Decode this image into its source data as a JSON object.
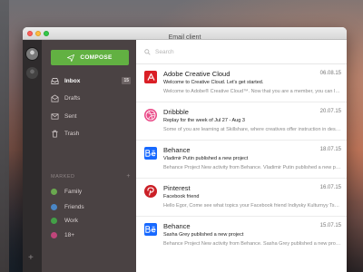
{
  "window": {
    "title": "Email client"
  },
  "sidebar": {
    "compose_label": "COMPOSE",
    "nav": [
      {
        "label": "Inbox",
        "badge": "15",
        "icon": "inbox-icon",
        "active": true
      },
      {
        "label": "Drafts",
        "icon": "drafts-icon"
      },
      {
        "label": "Sent",
        "icon": "sent-icon"
      },
      {
        "label": "Trash",
        "icon": "trash-icon"
      }
    ],
    "marked_heading": "MARKED",
    "marked_add": "+",
    "tags": [
      {
        "label": "Family",
        "color": "#6aa84f"
      },
      {
        "label": "Friends",
        "color": "#4a86c5"
      },
      {
        "label": "Work",
        "color": "#43a047"
      },
      {
        "label": "18+",
        "color": "#c0457a"
      }
    ]
  },
  "search": {
    "placeholder": "Search"
  },
  "emails": [
    {
      "sender": "Adobe Creative Cloud",
      "date": "06.08.15",
      "subject": "Welcome to Creative Cloud. Let's get started.",
      "preview": "Welcome to Adobe® Creative Cloud™. Now that you are a member, you can log in to your",
      "icon": "adobe-icon"
    },
    {
      "sender": "Dribbble",
      "date": "20.07.15",
      "subject": "Replay for the week of Jul 27 - Aug 3",
      "preview": "Some of you are learning at Skillshare, where creatives offer instruction in design and more",
      "icon": "dribbble-icon"
    },
    {
      "sender": "Behance",
      "date": "18.07.15",
      "subject": "Vladimir Putin published a new project",
      "preview": "Behance Project New activity from Behance. Vladimir Putin published a new project.",
      "icon": "behance-icon"
    },
    {
      "sender": "Pinterest",
      "date": "16.07.15",
      "subject": "Facebook friend",
      "preview": "Hello Egor, Come see what topics your Facebook friend Indiysky Kulturnyy Tsentr has",
      "icon": "pinterest-icon"
    },
    {
      "sender": "Behance",
      "date": "15.07.15",
      "subject": "Sasha Grey published a new project",
      "preview": "Behance Project New activity from Behance. Sasha Grey published a new project.",
      "icon": "behance-icon"
    }
  ],
  "add_account": "+",
  "colors": {
    "compose": "#62b142",
    "sidebar": "#4a4243",
    "iconbar": "#2e2b2c",
    "behance": "#1769ff",
    "pinterest": "#cb2027",
    "adobe": "#da1f26",
    "dribbble": "#ea4c89"
  }
}
